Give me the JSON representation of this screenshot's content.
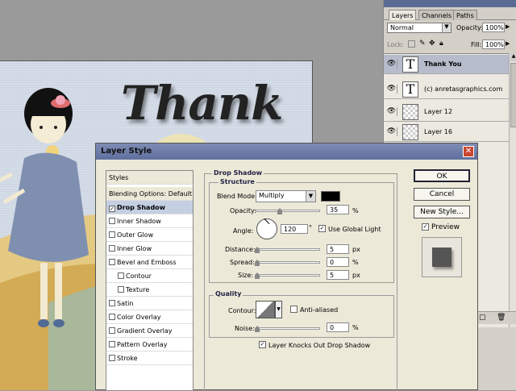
{
  "canvas": {
    "title_text": "Thank"
  },
  "layers_panel": {
    "tabs": [
      "Layers",
      "Channels",
      "Paths"
    ],
    "blend_mode": "Normal",
    "opacity_label": "Opacity:",
    "opacity_value": "100%",
    "lock_label": "Lock:",
    "fill_label": "Fill:",
    "fill_value": "100%",
    "layers": [
      {
        "name": "Thank You",
        "thumb": "T"
      },
      {
        "name": "(c) anretasgraphics.com",
        "thumb": "T"
      },
      {
        "name": "Layer 12",
        "thumb": ""
      },
      {
        "name": "Layer 16",
        "thumb": ""
      }
    ]
  },
  "dialog": {
    "title": "Layer Style",
    "styles_header": "Styles",
    "blending_options": "Blending Options: Default",
    "style_items": [
      {
        "label": "Drop Shadow",
        "checked": true
      },
      {
        "label": "Inner Shadow",
        "checked": false
      },
      {
        "label": "Outer Glow",
        "checked": false
      },
      {
        "label": "Inner Glow",
        "checked": false
      },
      {
        "label": "Bevel and Emboss",
        "checked": false
      },
      {
        "label": "Contour",
        "checked": false
      },
      {
        "label": "Texture",
        "checked": false
      },
      {
        "label": "Satin",
        "checked": false
      },
      {
        "label": "Color Overlay",
        "checked": false
      },
      {
        "label": "Gradient Overlay",
        "checked": false
      },
      {
        "label": "Pattern Overlay",
        "checked": false
      },
      {
        "label": "Stroke",
        "checked": false
      }
    ],
    "drop_shadow": {
      "group_title": "Drop Shadow",
      "structure_title": "Structure",
      "blend_mode_label": "Blend Mode:",
      "blend_mode_value": "Multiply",
      "opacity_label": "Opacity:",
      "opacity_value": "35",
      "angle_label": "Angle:",
      "angle_value": "120",
      "use_global_light": "Use Global Light",
      "distance_label": "Distance:",
      "distance_value": "5",
      "spread_label": "Spread:",
      "spread_value": "0",
      "size_label": "Size:",
      "size_value": "5",
      "px": "px",
      "pct": "%",
      "deg": "°"
    },
    "quality": {
      "title": "Quality",
      "contour_label": "Contour:",
      "anti_aliased": "Anti-aliased",
      "noise_label": "Noise:",
      "noise_value": "0",
      "knockout": "Layer Knocks Out Drop Shadow"
    },
    "buttons": {
      "ok": "OK",
      "cancel": "Cancel",
      "new_style": "New Style...",
      "preview": "Preview"
    }
  }
}
